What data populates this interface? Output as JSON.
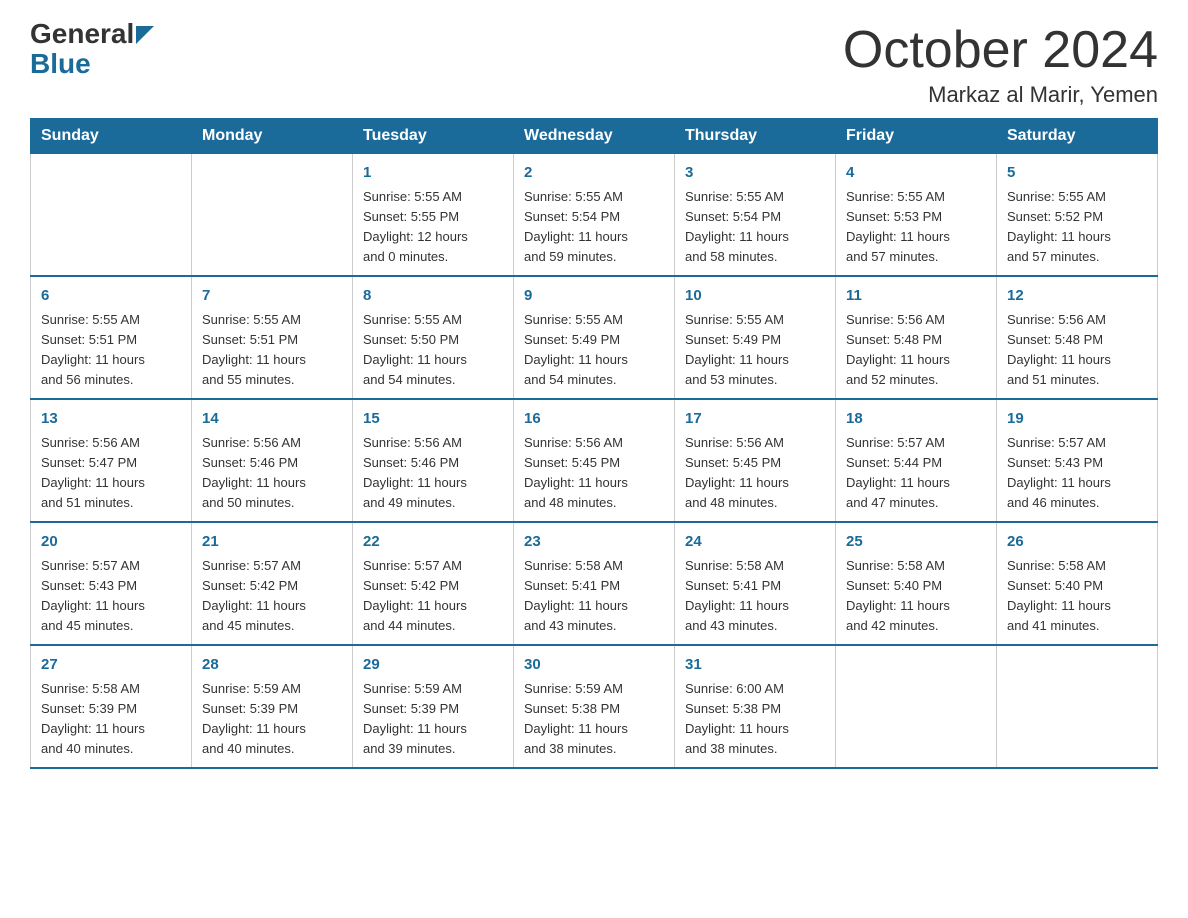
{
  "logo": {
    "general": "General",
    "blue": "Blue"
  },
  "title": "October 2024",
  "subtitle": "Markaz al Marir, Yemen",
  "days_of_week": [
    "Sunday",
    "Monday",
    "Tuesday",
    "Wednesday",
    "Thursday",
    "Friday",
    "Saturday"
  ],
  "weeks": [
    [
      {
        "day": "",
        "info": ""
      },
      {
        "day": "",
        "info": ""
      },
      {
        "day": "1",
        "info": "Sunrise: 5:55 AM\nSunset: 5:55 PM\nDaylight: 12 hours\nand 0 minutes."
      },
      {
        "day": "2",
        "info": "Sunrise: 5:55 AM\nSunset: 5:54 PM\nDaylight: 11 hours\nand 59 minutes."
      },
      {
        "day": "3",
        "info": "Sunrise: 5:55 AM\nSunset: 5:54 PM\nDaylight: 11 hours\nand 58 minutes."
      },
      {
        "day": "4",
        "info": "Sunrise: 5:55 AM\nSunset: 5:53 PM\nDaylight: 11 hours\nand 57 minutes."
      },
      {
        "day": "5",
        "info": "Sunrise: 5:55 AM\nSunset: 5:52 PM\nDaylight: 11 hours\nand 57 minutes."
      }
    ],
    [
      {
        "day": "6",
        "info": "Sunrise: 5:55 AM\nSunset: 5:51 PM\nDaylight: 11 hours\nand 56 minutes."
      },
      {
        "day": "7",
        "info": "Sunrise: 5:55 AM\nSunset: 5:51 PM\nDaylight: 11 hours\nand 55 minutes."
      },
      {
        "day": "8",
        "info": "Sunrise: 5:55 AM\nSunset: 5:50 PM\nDaylight: 11 hours\nand 54 minutes."
      },
      {
        "day": "9",
        "info": "Sunrise: 5:55 AM\nSunset: 5:49 PM\nDaylight: 11 hours\nand 54 minutes."
      },
      {
        "day": "10",
        "info": "Sunrise: 5:55 AM\nSunset: 5:49 PM\nDaylight: 11 hours\nand 53 minutes."
      },
      {
        "day": "11",
        "info": "Sunrise: 5:56 AM\nSunset: 5:48 PM\nDaylight: 11 hours\nand 52 minutes."
      },
      {
        "day": "12",
        "info": "Sunrise: 5:56 AM\nSunset: 5:48 PM\nDaylight: 11 hours\nand 51 minutes."
      }
    ],
    [
      {
        "day": "13",
        "info": "Sunrise: 5:56 AM\nSunset: 5:47 PM\nDaylight: 11 hours\nand 51 minutes."
      },
      {
        "day": "14",
        "info": "Sunrise: 5:56 AM\nSunset: 5:46 PM\nDaylight: 11 hours\nand 50 minutes."
      },
      {
        "day": "15",
        "info": "Sunrise: 5:56 AM\nSunset: 5:46 PM\nDaylight: 11 hours\nand 49 minutes."
      },
      {
        "day": "16",
        "info": "Sunrise: 5:56 AM\nSunset: 5:45 PM\nDaylight: 11 hours\nand 48 minutes."
      },
      {
        "day": "17",
        "info": "Sunrise: 5:56 AM\nSunset: 5:45 PM\nDaylight: 11 hours\nand 48 minutes."
      },
      {
        "day": "18",
        "info": "Sunrise: 5:57 AM\nSunset: 5:44 PM\nDaylight: 11 hours\nand 47 minutes."
      },
      {
        "day": "19",
        "info": "Sunrise: 5:57 AM\nSunset: 5:43 PM\nDaylight: 11 hours\nand 46 minutes."
      }
    ],
    [
      {
        "day": "20",
        "info": "Sunrise: 5:57 AM\nSunset: 5:43 PM\nDaylight: 11 hours\nand 45 minutes."
      },
      {
        "day": "21",
        "info": "Sunrise: 5:57 AM\nSunset: 5:42 PM\nDaylight: 11 hours\nand 45 minutes."
      },
      {
        "day": "22",
        "info": "Sunrise: 5:57 AM\nSunset: 5:42 PM\nDaylight: 11 hours\nand 44 minutes."
      },
      {
        "day": "23",
        "info": "Sunrise: 5:58 AM\nSunset: 5:41 PM\nDaylight: 11 hours\nand 43 minutes."
      },
      {
        "day": "24",
        "info": "Sunrise: 5:58 AM\nSunset: 5:41 PM\nDaylight: 11 hours\nand 43 minutes."
      },
      {
        "day": "25",
        "info": "Sunrise: 5:58 AM\nSunset: 5:40 PM\nDaylight: 11 hours\nand 42 minutes."
      },
      {
        "day": "26",
        "info": "Sunrise: 5:58 AM\nSunset: 5:40 PM\nDaylight: 11 hours\nand 41 minutes."
      }
    ],
    [
      {
        "day": "27",
        "info": "Sunrise: 5:58 AM\nSunset: 5:39 PM\nDaylight: 11 hours\nand 40 minutes."
      },
      {
        "day": "28",
        "info": "Sunrise: 5:59 AM\nSunset: 5:39 PM\nDaylight: 11 hours\nand 40 minutes."
      },
      {
        "day": "29",
        "info": "Sunrise: 5:59 AM\nSunset: 5:39 PM\nDaylight: 11 hours\nand 39 minutes."
      },
      {
        "day": "30",
        "info": "Sunrise: 5:59 AM\nSunset: 5:38 PM\nDaylight: 11 hours\nand 38 minutes."
      },
      {
        "day": "31",
        "info": "Sunrise: 6:00 AM\nSunset: 5:38 PM\nDaylight: 11 hours\nand 38 minutes."
      },
      {
        "day": "",
        "info": ""
      },
      {
        "day": "",
        "info": ""
      }
    ]
  ]
}
